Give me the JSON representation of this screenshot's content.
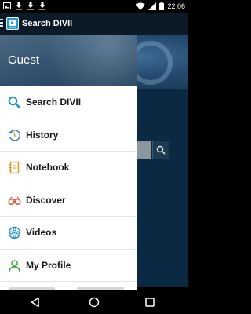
{
  "status_bar": {
    "time": "22:06",
    "icons": [
      "image-notification-icon",
      "download-icon",
      "download-icon",
      "download-icon",
      "wifi-icon",
      "signal-icon",
      "battery-icon"
    ]
  },
  "toolbar": {
    "title": "Search DIVII"
  },
  "drawer": {
    "user_label": "Guest",
    "items": [
      {
        "label": "Search DIVII",
        "icon": "search-icon",
        "color": "#1f8fd0"
      },
      {
        "label": "History",
        "icon": "history-icon",
        "color": "#2f7fc8"
      },
      {
        "label": "Notebook",
        "icon": "notebook-icon",
        "color": "#e39a1c"
      },
      {
        "label": "Discover",
        "icon": "binoculars-icon",
        "color": "#e0553a"
      },
      {
        "label": "Videos",
        "icon": "film-reel-icon",
        "color": "#1f8fd0"
      },
      {
        "label": "My Profile",
        "icon": "user-icon",
        "color": "#3aa53a"
      }
    ]
  },
  "navigation": {
    "buttons": [
      "back-icon",
      "home-icon",
      "recents-icon"
    ]
  },
  "colors": {
    "toolbar": "#0b1a26",
    "drawer_header": "#34536e",
    "background": "#0b2943"
  }
}
